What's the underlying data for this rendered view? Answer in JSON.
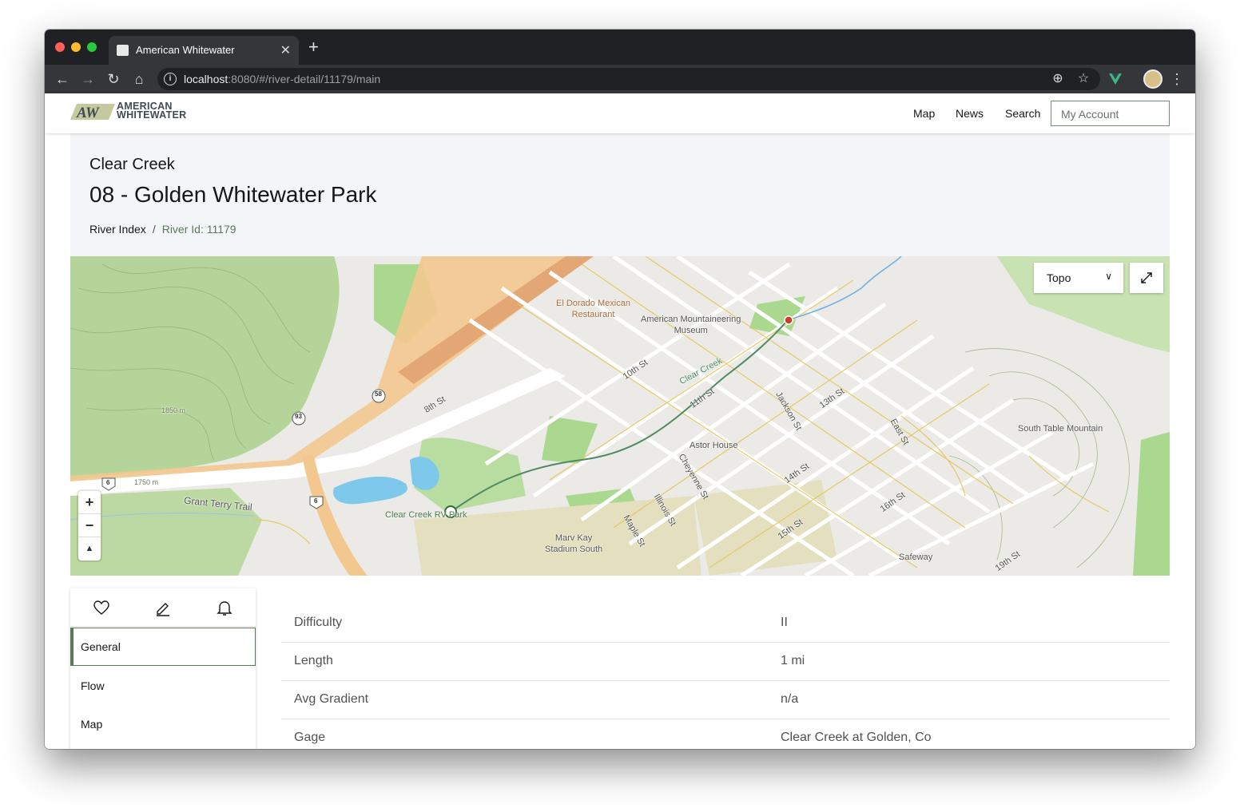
{
  "browser": {
    "tab_title": "American Whitewater",
    "url_host": "localhost",
    "url_rest": ":8080/#/river-detail/11179/main"
  },
  "header": {
    "logo_line1": "AMERICAN",
    "logo_line2": "WHITEWATER",
    "nav": [
      "Map",
      "News",
      "Search"
    ],
    "account_label": "My Account"
  },
  "hero": {
    "river_name": "Clear Creek",
    "section_name": "08 - Golden Whitewater Park",
    "breadcrumb_root": "River Index",
    "breadcrumb_sep": "/",
    "breadcrumb_current": "River Id: 11179"
  },
  "map": {
    "basemap": "Topo",
    "labels": {
      "restaurant": "El Dorado Mexican\nRestaurant",
      "museum": "American Mountaineering\nMuseum",
      "astor": "Astor House",
      "table_mtn": "South Table Mountain",
      "rv_park": "Clear Creek RV Park",
      "stadium": "Marv Kay\nStadium South",
      "safeway": "Safeway",
      "creek": "Clear Creek",
      "grant_terry": "Grant Terry Trail",
      "st_10": "10th St",
      "st_11": "11th St",
      "st_13": "13th St",
      "st_14": "14th St",
      "st_15": "15th St",
      "st_16": "16th St",
      "st_19": "19th St",
      "st_8": "8th St",
      "jackson": "Jackson St",
      "cheyenne": "Cheyenne St",
      "illinois": "Illinois St",
      "maple": "Maple St",
      "east": "East St",
      "elev_1850": "1850 m",
      "elev_1750": "1750 m",
      "route_58": "58",
      "route_93": "93",
      "route_6a": "6",
      "route_6b": "6"
    },
    "zoom_in": "+",
    "zoom_out": "−",
    "compass": "▲"
  },
  "side_nav": {
    "items": [
      "General",
      "Flow",
      "Map"
    ],
    "active": "General"
  },
  "details": [
    {
      "label": "Difficulty",
      "value": "II"
    },
    {
      "label": "Length",
      "value": "1 mi"
    },
    {
      "label": "Avg Gradient",
      "value": "n/a"
    },
    {
      "label": "Gage",
      "value": "Clear Creek at Golden, Co"
    }
  ],
  "colors": {
    "accent": "#5a7a5a",
    "hero_bg": "#f4f5f8",
    "chrome_dark": "#202124",
    "chrome_mid": "#35363a"
  }
}
